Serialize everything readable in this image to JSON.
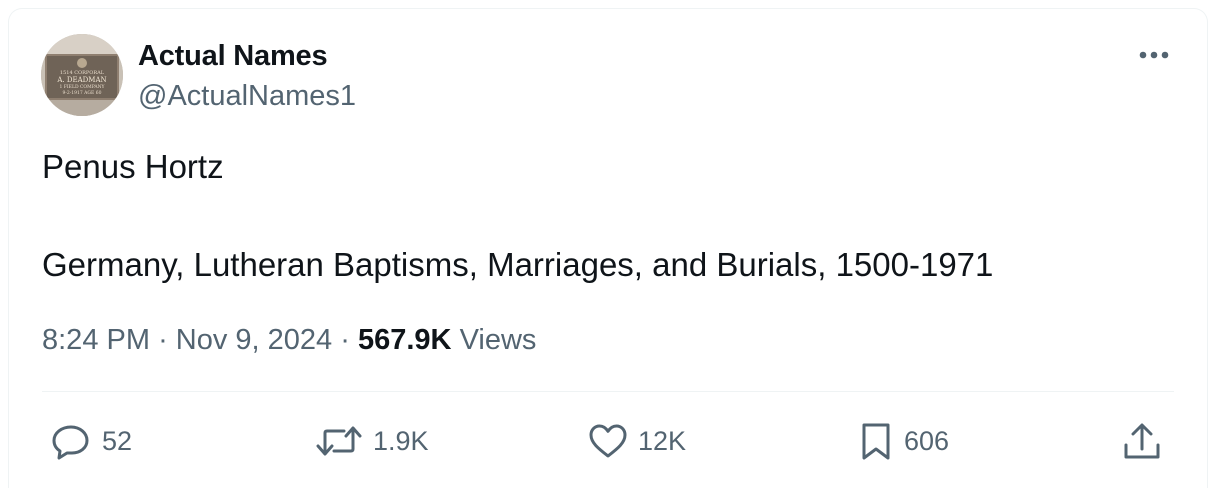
{
  "author": {
    "display_name": "Actual Names",
    "handle": "@ActualNames1",
    "avatar_text": [
      "1514 CORPORAL",
      "A. DEADMAN",
      "1 FIELD COMPANY",
      "9-2-1917 AGE 60"
    ]
  },
  "tweet": {
    "line1": "Penus Hortz",
    "line2": "Germany, Lutheran Baptisms, Marriages, and Burials, 1500-1971",
    "time": "8:24 PM",
    "date": "Nov 9, 2024",
    "separator": "·",
    "views_count": "567.9K",
    "views_label": "Views"
  },
  "actions": {
    "replies": "52",
    "reposts": "1.9K",
    "likes": "12K",
    "bookmarks": "606"
  },
  "icons": {
    "reply": "reply-icon",
    "repost": "repost-icon",
    "like": "heart-icon",
    "bookmark": "bookmark-icon",
    "share": "share-icon",
    "more": "more-icon"
  },
  "colors": {
    "text": "#0f1419",
    "secondary": "#536471",
    "divider": "#eff3f4"
  }
}
